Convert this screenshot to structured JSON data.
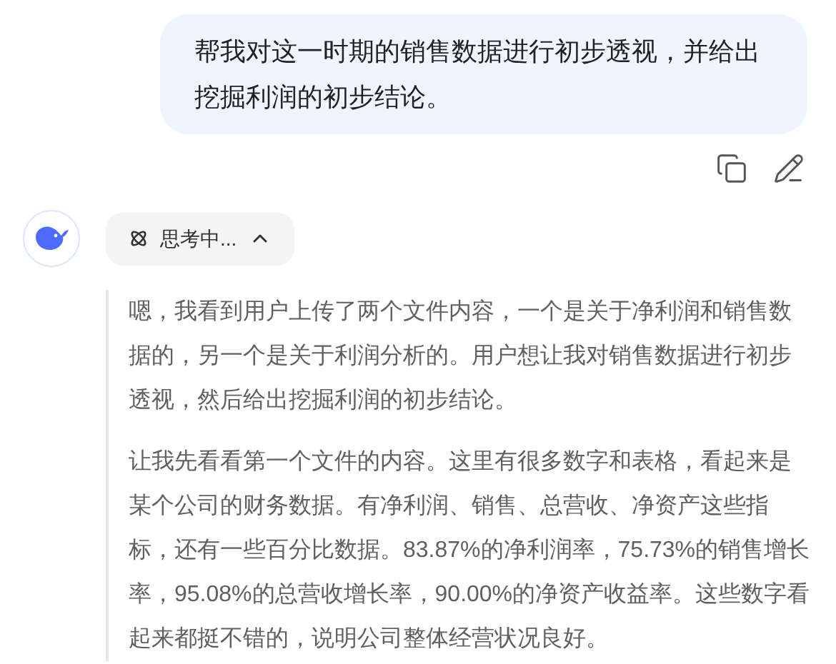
{
  "user_message": {
    "text": "帮我对这一时期的销售数据进行初步透视，并给出挖掘利润的初步结论。"
  },
  "thinking": {
    "label": "思考中...",
    "expanded": true,
    "paragraphs": [
      "嗯，我看到用户上传了两个文件内容，一个是关于净利润和销售数据的，另一个是关于利润分析的。用户想让我对销售数据进行初步透视，然后给出挖掘利润的初步结论。",
      "让我先看看第一个文件的内容。这里有很多数字和表格，看起来是某个公司的财务数据。有净利润、销售、总营收、净资产这些指标，还有一些百分比数据。83.87%的净利润率，75.73%的销售增长率，95.08%的总营收增长率，90.00%的净资产收益率。这些数字看起来都挺不错的，说明公司整体经营状况良好。"
    ]
  }
}
